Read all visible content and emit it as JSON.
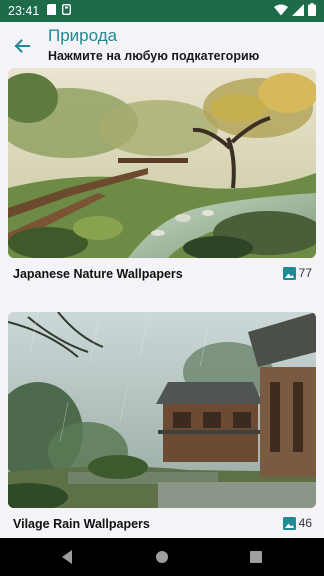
{
  "status_bar": {
    "time": "23:41",
    "left_icons": [
      "sim-card-icon",
      "storage-icon"
    ],
    "right_icons": [
      "wifi-icon",
      "signal-icon",
      "battery-icon"
    ]
  },
  "header": {
    "title": "Природа",
    "subtitle": "Нажмите на любую подкатегорию",
    "back_icon": "arrow-left-icon"
  },
  "subcategories": [
    {
      "title": "Japanese Nature Wallpapers",
      "count": "77",
      "count_icon": "gallery-icon"
    },
    {
      "title": "Vilage Rain Wallpapers",
      "count": "46",
      "count_icon": "gallery-icon"
    }
  ],
  "nav_bar": {
    "buttons": [
      "back-triangle-icon",
      "home-circle-icon",
      "recents-square-icon"
    ]
  },
  "colors": {
    "status_bar": "#1e6b4a",
    "accent": "#1f8a93",
    "background": "#f4f4f8"
  }
}
